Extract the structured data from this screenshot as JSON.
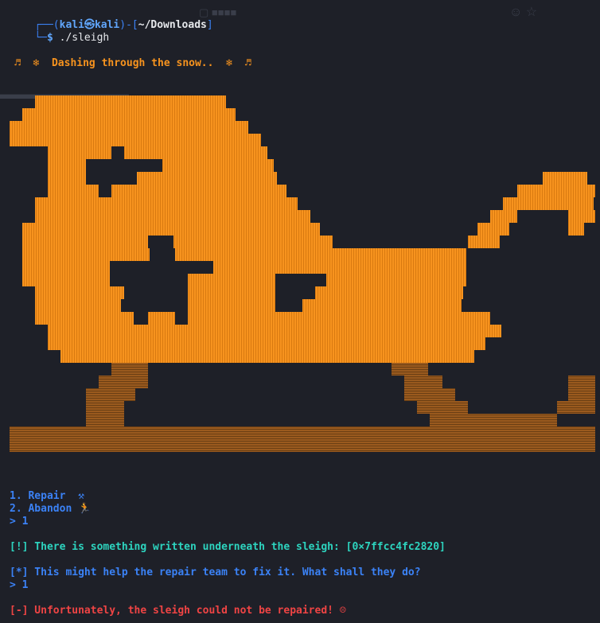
{
  "prompt": {
    "top_prefix": "┌──(",
    "user": "kali",
    "at": "㉿",
    "host": "kali",
    "mid": ")-[",
    "path": "~/Downloads",
    "close": "]",
    "bottom_prefix": "└─",
    "dollar": "$",
    "command": "./sleigh"
  },
  "song": "♬  ❄  Dashing through the snow..  ❄  ♬",
  "menu": {
    "option1": "1. Repair  ⚒",
    "option2": "2. Abandon 🏃",
    "input1": "> 1"
  },
  "messages": {
    "info_prefix": "[!]",
    "info_text": " There is something written underneath the sleigh: [0×7ffcc4fc2820]",
    "help_prefix": "[*]",
    "help_text": " This might help the repair team to fix it. What shall they do?",
    "input2": "> 1",
    "error": "[-] Unfortunately, the sleigh could not be repaired! ☹"
  },
  "colors": {
    "background": "#1e2028",
    "sleigh_body": "#f7931e",
    "sleigh_runners": "#9a5a1e",
    "prompt_blue": "#3b82f6",
    "info_cyan": "#2dd4bf",
    "error_red": "#ef4444"
  },
  "icons": [
    "music-note-icon",
    "snowflake-icon",
    "hammer-icon",
    "running-person-icon",
    "sad-face-icon"
  ]
}
